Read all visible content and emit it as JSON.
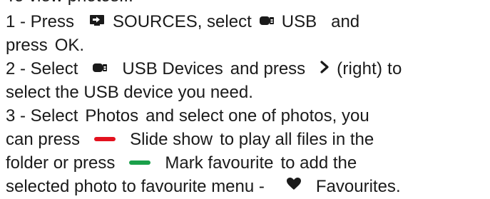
{
  "doc": {
    "cut_top": "To view photos...",
    "l1": {
      "a": "1 -  Press",
      "b": "SOURCES",
      "c": ", select",
      "d": "USB",
      "e": "and"
    },
    "l2": {
      "a": "press",
      "b": "OK",
      "c": "."
    },
    "l3": {
      "a": "2 -  Select",
      "b": "USB Devices",
      "c": "and press",
      "d": "(right) to"
    },
    "l4": {
      "a": "select the USB device you need."
    },
    "l5": {
      "a": "3 -  Select",
      "b": "Photos",
      "c": "and select one of photos, you"
    },
    "l6": {
      "a": "can press",
      "b": "Slide show",
      "c": "to play all files in the"
    },
    "l7": {
      "a": "folder or press",
      "b": "Mark favourite",
      "c": "to add the"
    },
    "l8": {
      "a": "selected photo to favourite menu -",
      "b": "Favourites",
      "c": "."
    }
  },
  "icons": {
    "sources": "sources-icon",
    "usb": "usb-icon",
    "right": "chevron-right-icon",
    "red": "red-color-key-icon",
    "green": "green-color-key-icon",
    "heart": "heart-icon"
  },
  "colors": {
    "text": "#1a1a1a",
    "red_key": "#e3121e",
    "green_key": "#1aa04a"
  }
}
